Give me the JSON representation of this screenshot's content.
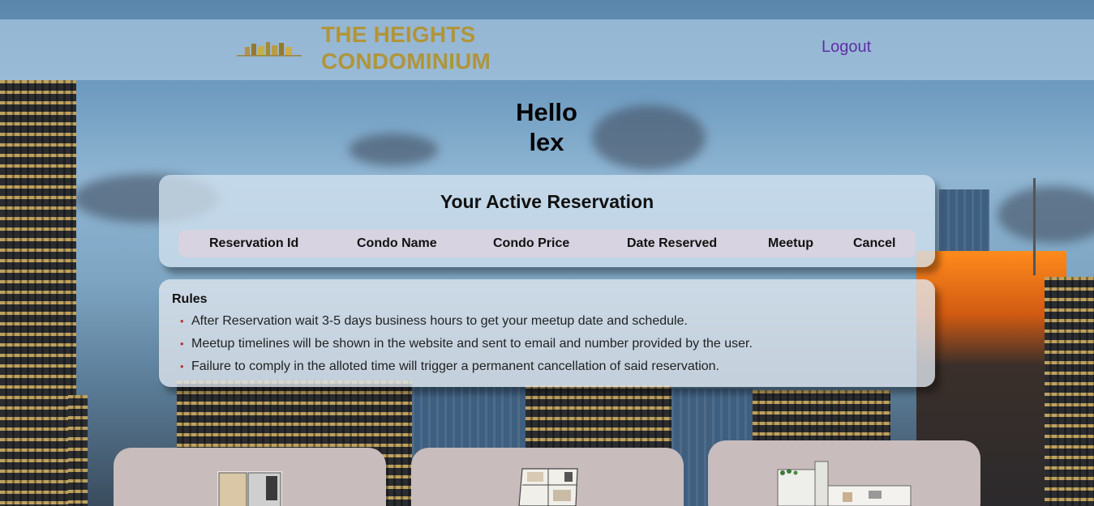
{
  "header": {
    "brand_line1": "THE HEIGHTS",
    "brand_line2": "CONDOMINIUM",
    "logout_label": "Logout"
  },
  "greeting": {
    "hello": "Hello",
    "username": "lex"
  },
  "reservation": {
    "title": "Your Active Reservation",
    "columns": [
      "Reservation Id",
      "Condo Name",
      "Condo Price",
      "Date Reserved",
      "Meetup",
      "Cancel"
    ]
  },
  "rules": {
    "title": "Rules",
    "items": [
      "After Reservation wait 3-5 days business hours to get your meetup date and schedule.",
      "Meetup timelines will be shown in the website and sent to email and number provided by the user.",
      "Failure to comply in the alloted time will trigger a permanent cancellation of said reservation."
    ]
  },
  "floorplan_cards": [
    {
      "icon": "floor-plan-studio"
    },
    {
      "icon": "floor-plan-two-bedroom"
    },
    {
      "icon": "floor-plan-penthouse"
    }
  ],
  "colors": {
    "brand_gold": "#b0953a",
    "logout_purple": "#5e2fa6",
    "rules_bullet": "#c0322e"
  }
}
